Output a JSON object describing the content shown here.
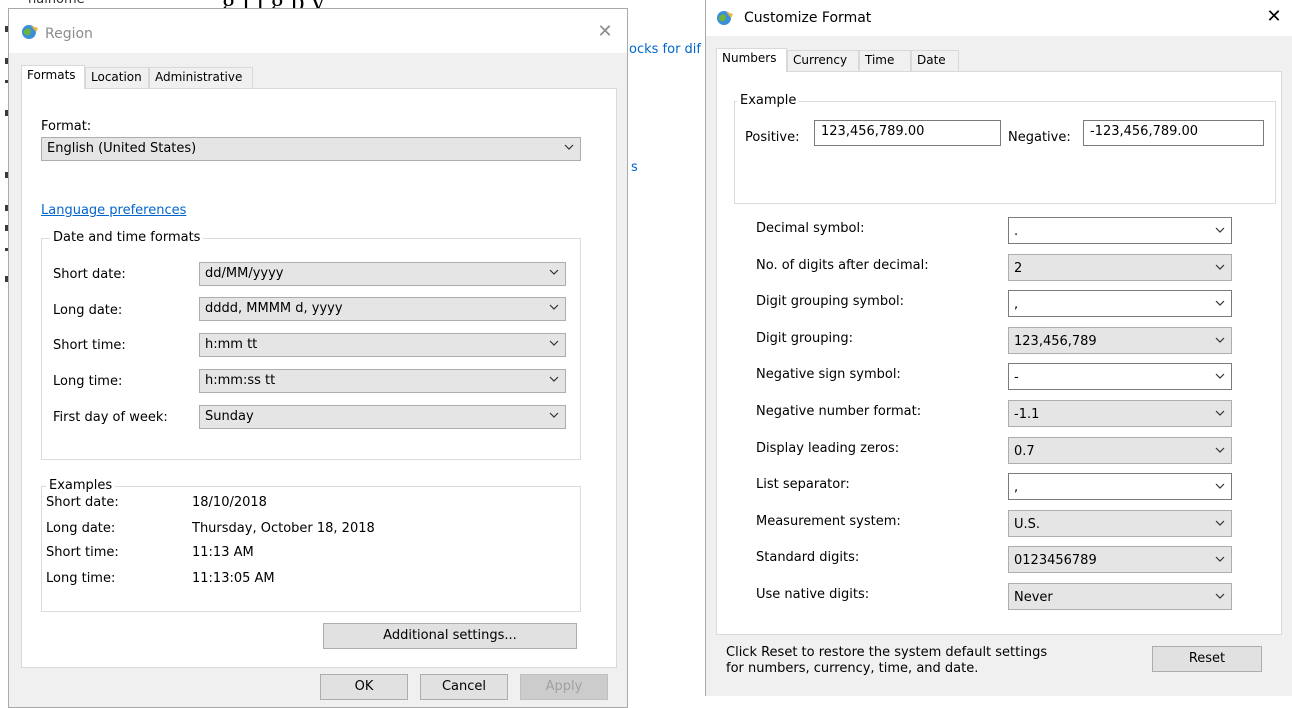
{
  "background": {
    "top_text": "g    i     i  g p       y",
    "top_left_fragment": "nalhome",
    "link_fragment_1": "ocks for dif",
    "link_fragment_2": "s"
  },
  "region": {
    "title": "Region",
    "tabs": [
      "Formats",
      "Location",
      "Administrative"
    ],
    "format_label": "Format:",
    "format_value": "English (United States)",
    "language_link": "Language preferences",
    "dt_group_title": "Date and time formats",
    "dt_rows": [
      {
        "label": "Short date:",
        "value": "dd/MM/yyyy"
      },
      {
        "label": "Long date:",
        "value": "dddd, MMMM d, yyyy"
      },
      {
        "label": "Short time:",
        "value": "h:mm tt"
      },
      {
        "label": "Long time:",
        "value": "h:mm:ss tt"
      },
      {
        "label": "First day of week:",
        "value": "Sunday"
      }
    ],
    "examples_title": "Examples",
    "examples": [
      {
        "label": "Short date:",
        "value": "18/10/2018"
      },
      {
        "label": "Long date:",
        "value": "Thursday, October 18, 2018"
      },
      {
        "label": "Short time:",
        "value": "11:13 AM"
      },
      {
        "label": "Long time:",
        "value": "11:13:05 AM"
      }
    ],
    "additional_btn": "Additional settings...",
    "ok_btn": "OK",
    "cancel_btn": "Cancel",
    "apply_btn": "Apply"
  },
  "customize": {
    "title": "Customize Format",
    "tabs": [
      "Numbers",
      "Currency",
      "Time",
      "Date"
    ],
    "example_title": "Example",
    "positive_label": "Positive:",
    "positive_value": "123,456,789.00",
    "negative_label": "Negative:",
    "negative_value": "-123,456,789.00",
    "rows": [
      {
        "label": "Decimal symbol:",
        "value": ".",
        "editable": true
      },
      {
        "label": "No. of digits after decimal:",
        "value": "2",
        "editable": false
      },
      {
        "label": "Digit grouping symbol:",
        "value": ",",
        "editable": true
      },
      {
        "label": "Digit grouping:",
        "value": "123,456,789",
        "editable": false
      },
      {
        "label": "Negative sign symbol:",
        "value": "-",
        "editable": true
      },
      {
        "label": "Negative number format:",
        "value": "-1.1",
        "editable": false
      },
      {
        "label": "Display leading zeros:",
        "value": "0.7",
        "editable": false
      },
      {
        "label": "List separator:",
        "value": ",",
        "editable": true
      },
      {
        "label": "Measurement system:",
        "value": "U.S.",
        "editable": false
      },
      {
        "label": "Standard digits:",
        "value": "0123456789",
        "editable": false
      },
      {
        "label": "Use native digits:",
        "value": "Never",
        "editable": false
      }
    ],
    "reset_note": "Click Reset to restore the system default settings for numbers, currency, time, and date.",
    "reset_btn": "Reset"
  },
  "colors": {
    "link": "#0066cc",
    "dialog_bg": "#f0f0f0",
    "combo_bg": "#e5e5e5"
  },
  "icons": [
    "globe-icon",
    "close-icon",
    "chevron-down-icon"
  ]
}
